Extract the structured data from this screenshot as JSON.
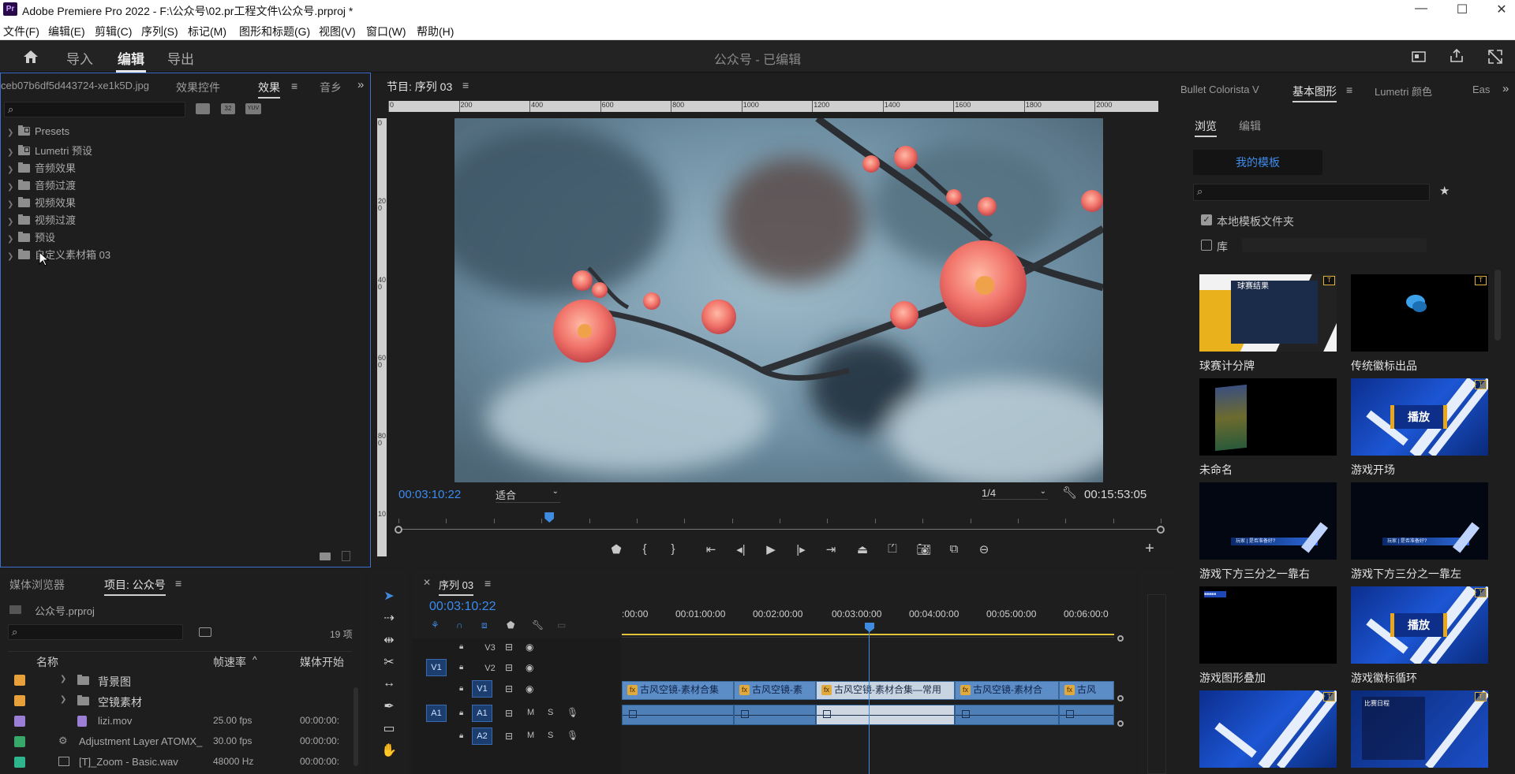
{
  "window": {
    "app_icon": "Pr",
    "title": "Adobe Premiere Pro 2022 - F:\\公众号\\02.pr工程文件\\公众号.prproj *",
    "controls": {
      "minimize": "—",
      "maximize": "☐",
      "close": "✕"
    }
  },
  "menu": [
    "文件(F)",
    "编辑(E)",
    "剪辑(C)",
    "序列(S)",
    "标记(M)",
    "图形和标题(G)",
    "视图(V)",
    "窗口(W)",
    "帮助(H)"
  ],
  "header": {
    "tabs": [
      "导入",
      "编辑",
      "导出"
    ],
    "active_tab": "编辑",
    "workspace_title": "公众号 - 已编辑"
  },
  "effects_panel": {
    "tabs": [
      "ceb07b6df5d443724-xe1k5D.jpg",
      "效果控件",
      "效果",
      "音乡"
    ],
    "active_tab": "效果",
    "search_placeholder": "",
    "tree": [
      "Presets",
      "Lumetri 预设",
      "音频效果",
      "音频过渡",
      "视频效果",
      "视频过渡",
      "预设",
      "自定义素材箱 03"
    ],
    "filter_icons": [
      "32",
      "YUV"
    ]
  },
  "program_monitor": {
    "title": "节目: 序列 03",
    "ruler_h": [
      "0",
      "200",
      "400",
      "600",
      "800",
      "1000",
      "1200",
      "1400",
      "1600",
      "1800",
      "2000"
    ],
    "ruler_v": [
      "0",
      "2 0 0",
      "4 0 0",
      "6 0 0",
      "8 0 0",
      "1 0"
    ],
    "current_time": "00:03:10:22",
    "fit": "适合",
    "resolution": "1/4",
    "duration": "00:15:53:05",
    "playhead_fraction": 0.198
  },
  "essential_graphics": {
    "tabs": [
      "Bullet Colorista V",
      "基本图形",
      "Lumetri 颜色",
      "Eas"
    ],
    "active_tab": "基本图形",
    "subtabs": [
      "浏览",
      "编辑"
    ],
    "active_subtab": "浏览",
    "template_button": "我的模板",
    "local_folder_label": "本地模板文件夹",
    "local_folder_checked": true,
    "library_label": "库",
    "library_checked": false,
    "templates": [
      {
        "label": "球赛计分牌",
        "style": "scoreboard",
        "thumb_text": "球赛结果"
      },
      {
        "label": "传统徽标出品",
        "style": "logo"
      },
      {
        "label": "未命名",
        "style": "unnamed"
      },
      {
        "label": "游戏开场",
        "style": "game",
        "thumb_text": "播放"
      },
      {
        "label": "游戏下方三分之一靠右",
        "style": "lower-right",
        "thumb_text": "玩家 | 是否准备好?"
      },
      {
        "label": "游戏下方三分之一靠左",
        "style": "lower-left",
        "thumb_text": "玩家 | 是否准备好?"
      },
      {
        "label": "游戏图形叠加",
        "style": "overlay",
        "thumb_text": "■■■■■"
      },
      {
        "label": "游戏徽标循环",
        "style": "game",
        "thumb_text": "播放"
      },
      {
        "label": "",
        "style": "blue"
      },
      {
        "label": "",
        "style": "list",
        "thumb_text": "比赛日程"
      }
    ]
  },
  "project_panel": {
    "tabs": [
      "媒体浏览器",
      "项目: 公众号"
    ],
    "active_tab": "项目: 公众号",
    "file": "公众号.prproj",
    "item_count": "19 项",
    "columns": [
      "名称",
      "帧速率",
      "媒体开始"
    ],
    "rows": [
      {
        "name": "背景图",
        "type": "bin",
        "rate": "",
        "start": "",
        "color": "#e8a03a"
      },
      {
        "name": "空镜素材",
        "type": "bin",
        "rate": "",
        "start": "",
        "color": "#e8a03a"
      },
      {
        "name": "lizi.mov",
        "type": "clip",
        "rate": "25.00 fps",
        "start": "00:00:00:",
        "color": "#9b7fd6"
      },
      {
        "name": "Adjustment Layer ATOMX_",
        "type": "adjust",
        "rate": "30.00 fps",
        "start": "00:00:00:",
        "color": "#38a86a"
      },
      {
        "name": "[T]_Zoom - Basic.wav",
        "type": "audio",
        "rate": "48000 Hz",
        "start": "00:00:00:",
        "color": "#2fb58e"
      }
    ]
  },
  "timeline": {
    "title": "序列 03",
    "current_time": "00:03:10:22",
    "ruler": [
      ":00:00",
      "00:01:00:00",
      "00:02:00:00",
      "00:03:00:00",
      "00:04:00:00",
      "00:05:00:00",
      "00:06:00:0"
    ],
    "tracks": [
      {
        "id": "V3",
        "src": "",
        "type": "video"
      },
      {
        "id": "V2",
        "src": "V1",
        "type": "video"
      },
      {
        "id": "V1",
        "src": "",
        "type": "video",
        "target": true
      },
      {
        "id": "A1",
        "src": "A1",
        "type": "audio",
        "target": true
      },
      {
        "id": "A2",
        "src": "",
        "type": "audio"
      }
    ],
    "mute_label": "M",
    "solo_label": "S",
    "clips_v1": [
      {
        "label": "古风空镜-素材合集",
        "selected": false
      },
      {
        "label": "古风空镜-素",
        "selected": false
      },
      {
        "label": "古风空镜-素材合集—常用",
        "selected": true
      },
      {
        "label": "古风空镜-素材合",
        "selected": false
      },
      {
        "label": "古风",
        "selected": false
      }
    ],
    "fx_badge": "fx"
  },
  "colors": {
    "accent_blue": "#3b8cf0",
    "playhead": "#3f8be0",
    "active_border": "#3d6fd1",
    "work_area": "#e2c43a"
  }
}
